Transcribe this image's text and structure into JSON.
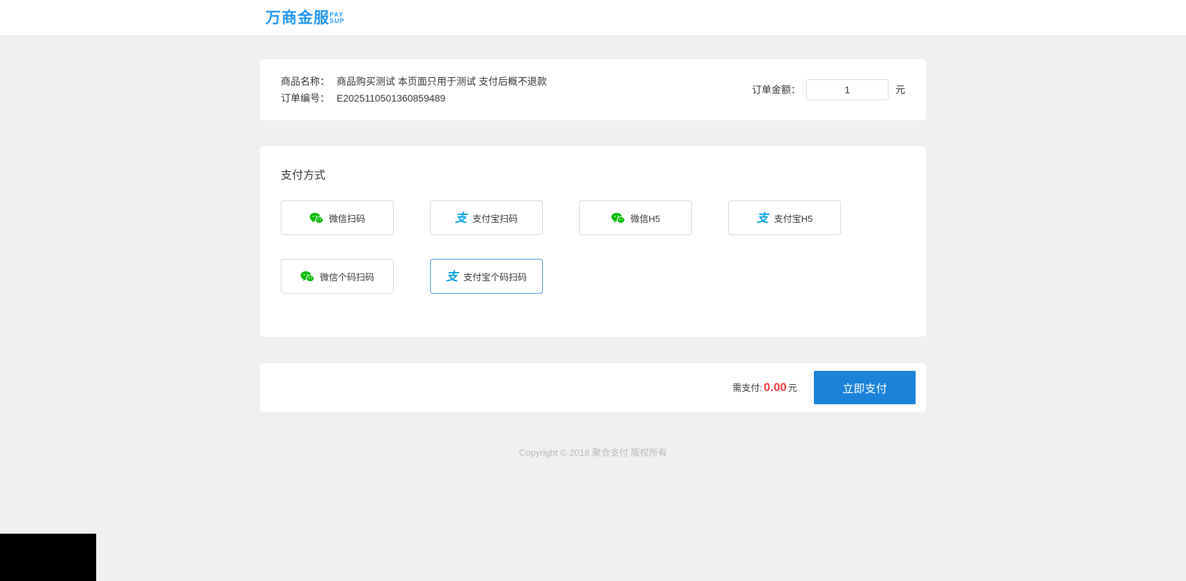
{
  "header": {
    "brand": "万商金服",
    "brand_sub_top": "PAY",
    "brand_sub_bottom": "SUP"
  },
  "order": {
    "product_label": "商品名称：",
    "product_value": "商品购买测试 本页面只用于测试 支付后概不退款",
    "order_no_label": "订单编号：",
    "order_no_value": "E2025110501360859489",
    "amount_label": "订单金额：",
    "amount_value": "1",
    "amount_unit": "元"
  },
  "payment": {
    "section_title": "支付方式",
    "methods": [
      {
        "label": "微信扫码",
        "icon": "wechat-pay-icon",
        "selected": false
      },
      {
        "label": "支付宝扫码",
        "icon": "alipay-icon",
        "selected": false
      },
      {
        "label": "微信H5",
        "icon": "wechat-pay-icon",
        "selected": false
      },
      {
        "label": "支付宝H5",
        "icon": "alipay-icon",
        "selected": false
      },
      {
        "label": "微信个码扫码",
        "icon": "wechat-pay-icon",
        "selected": false
      },
      {
        "label": "支付宝个码扫码",
        "icon": "alipay-icon",
        "selected": true
      }
    ]
  },
  "checkout": {
    "due_label": "需支付:",
    "due_amount": "0.00",
    "due_unit": "元",
    "pay_button_label": "立即支付"
  },
  "footer": {
    "copyright": "Copyright © 2018 聚合支付 版权所有"
  },
  "colors": {
    "brand_blue": "#2196f3",
    "wechat_green": "#09bb07",
    "alipay_blue": "#00a0e9",
    "price_red": "#f43c3c",
    "pay_button_blue": "#1a82d9",
    "selected_border_blue": "#4b93e6"
  }
}
